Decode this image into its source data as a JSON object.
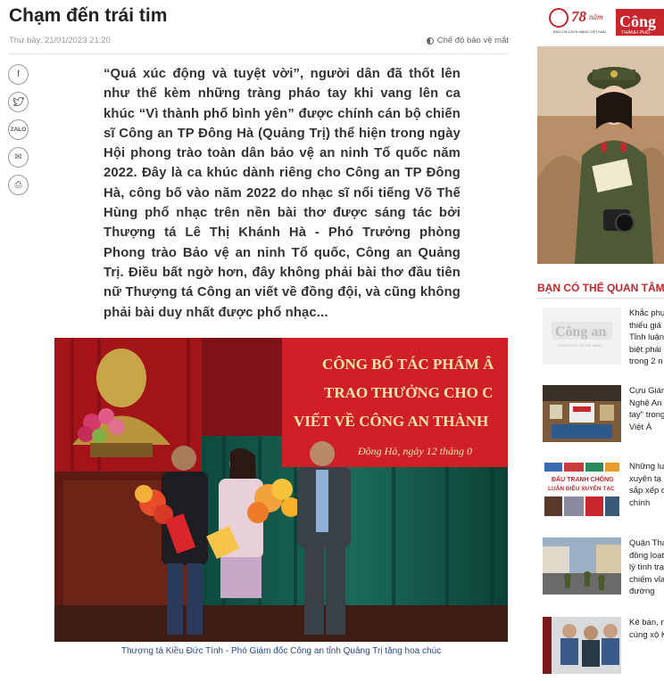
{
  "article": {
    "title": "Chạm đến trái tim",
    "date": "Thứ bảy, 21/01/2023 21:20",
    "reading_mode": "Chế độ bảo vệ mắt",
    "share": [
      {
        "icon": "facebook-icon",
        "glyph": "f"
      },
      {
        "icon": "twitter-icon",
        "glyph": "t"
      },
      {
        "icon": "zalo-icon",
        "glyph": "ZALO"
      },
      {
        "icon": "email-icon",
        "glyph": "✉"
      },
      {
        "icon": "print-icon",
        "glyph": "⎙"
      }
    ],
    "lead": "“Quá xúc động và tuyệt vời”, người dân đã thốt lên như thế kèm những tràng pháo tay khi vang lên ca khúc “Vì thành phố bình yên” được chính cán bộ chiến sĩ Công an TP Đông Hà (Quảng Trị) thể hiện trong ngày Hội phong trào toàn dân bảo vệ an ninh Tổ quốc năm 2022. Đây là ca khúc dành riêng cho Công an TP Đông Hà, công bố vào năm 2022 do nhạc sĩ nổi tiếng Võ Thế Hùng phổ nhạc trên nền bài thơ được sáng tác bởi Thượng tá Lê Thị Khánh Hà - Phó Trưởng phòng Phong trào Bảo vệ an ninh Tổ quốc, Công an Quảng Trị. Điều bất ngờ hơn, đây không phải bài thơ đầu tiên nữ Thượng tá Công an viết về đồng đội, và cũng không phải bài duy nhất được phổ nhạc...",
    "photo": {
      "banner_lines": [
        "CÔNG BỐ TÁC PHẨM Â",
        "TRAO THƯỞNG CHO C",
        "VIẾT VỀ CÔNG AN THÀNH"
      ],
      "banner_date": "Đông Hà, ngày 12 tháng 0"
    },
    "caption": "Thượng tá Kiều Đức Tính - Phó Giám đốc Công an tỉnh Quảng Trị tặng hoa chúc"
  },
  "sidebar": {
    "ad": {
      "years_number": "78",
      "years_word": "năm",
      "tagline": "BÁO CHÍ CÁCH MẠNG VIỆT NAM",
      "logo": "Công",
      "logo_sub": "THÀNH PHỐ"
    },
    "related_title": "BẠN CÓ THỂ QUAN TÂM",
    "items": [
      {
        "lines": [
          "Khắc phụ",
          "thiếu giá",
          "Tỉnh luận",
          "biệt phái",
          "trong 2 n"
        ],
        "thumb_text": "Công an",
        "thumb_sub": "THÀNH PHỐ HỒ CHÍ MINH"
      },
      {
        "lines": [
          "Cựu Giám",
          "Nghệ An",
          "tay\" trong",
          "Việt Á"
        ],
        "thumb_text": "",
        "thumb_sub": ""
      },
      {
        "lines": [
          "Những lu",
          "xuyên tạ",
          "sắp xếp d",
          "chính"
        ],
        "thumb_text": "ĐẤU TRANH CHỐNG",
        "thumb_sub": "LUẬN ĐIỆU XUYÊN TẠC"
      },
      {
        "lines": [
          "Quận Tha",
          "đồng loạt",
          "lý tình trạ",
          "chiếm vỉa",
          "đường"
        ],
        "thumb_text": "",
        "thumb_sub": ""
      },
      {
        "lines": [
          "Kẻ bán, n",
          "cùng xộ K"
        ],
        "thumb_text": "",
        "thumb_sub": ""
      }
    ]
  },
  "colors": {
    "accent": "#c9252c",
    "caption": "#2b4a8c",
    "banner": "#d11f27"
  }
}
